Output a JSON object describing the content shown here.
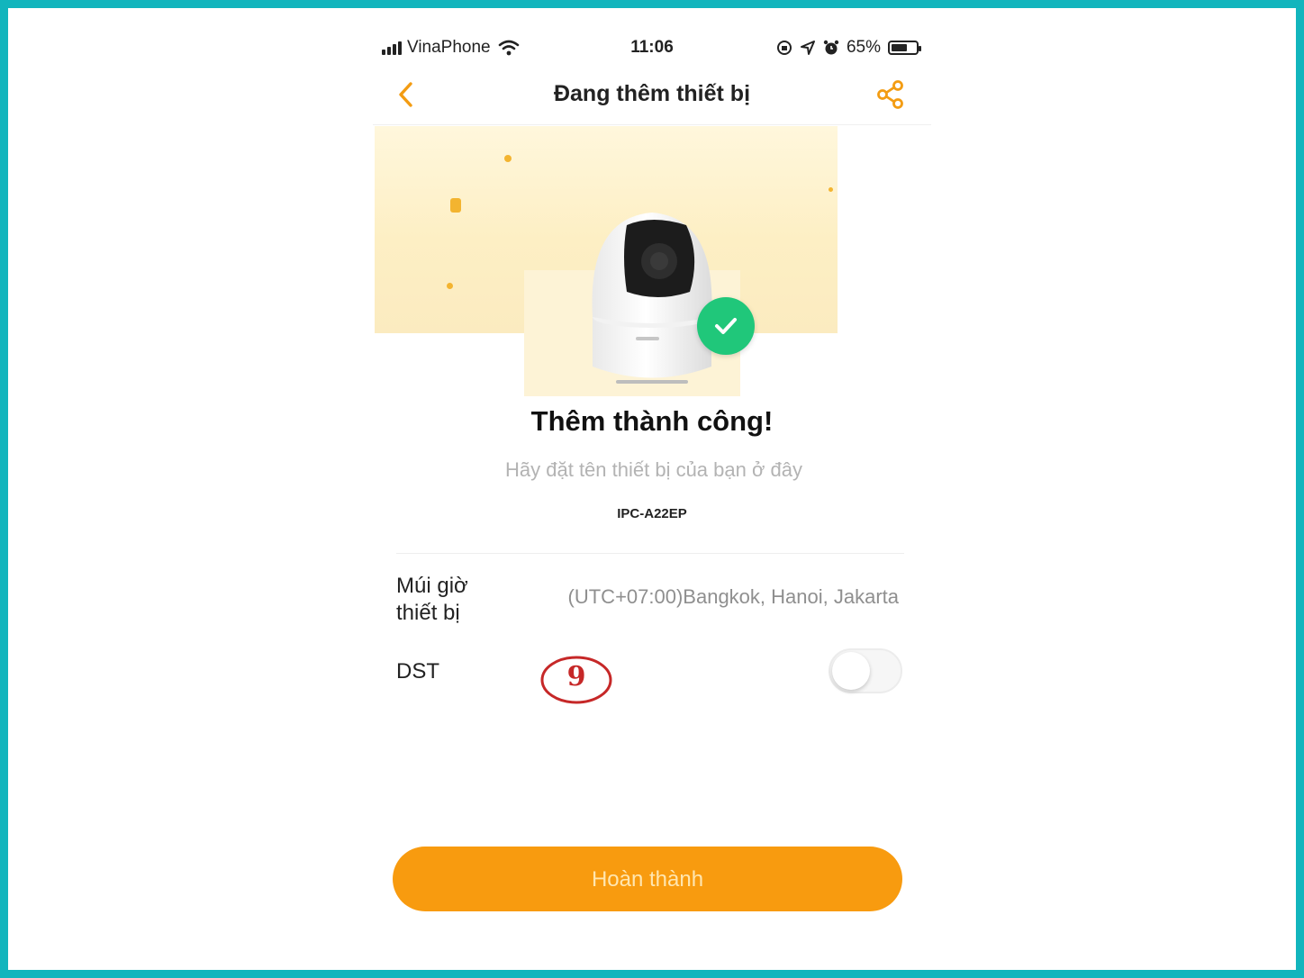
{
  "status_bar": {
    "carrier": "VinaPhone",
    "time": "11:06",
    "battery_text": "65%",
    "battery_level": 0.65
  },
  "nav": {
    "title": "Đang thêm thiết bị",
    "back_icon": "chevron-left-icon",
    "share_icon": "share-icon"
  },
  "result": {
    "title": "Thêm thành công!",
    "name_placeholder": "Hãy đặt tên thiết bị của bạn ở đây",
    "name_value": "",
    "model": "IPC-A22EP"
  },
  "settings": {
    "timezone_label": "Múi giờ thiết bị",
    "timezone_label_line1": "Múi giờ",
    "timezone_label_line2": "thiết bị",
    "timezone_value": "(UTC+07:00)Bangkok, Hanoi, Jakarta",
    "dst_label": "DST",
    "dst_enabled": false
  },
  "annotation": {
    "step": "9",
    "color": "#c62828"
  },
  "actions": {
    "done_label": "Hoàn thành"
  },
  "colors": {
    "accent": "#f89b0f",
    "success": "#20c77a",
    "frame": "#12b5bd"
  }
}
